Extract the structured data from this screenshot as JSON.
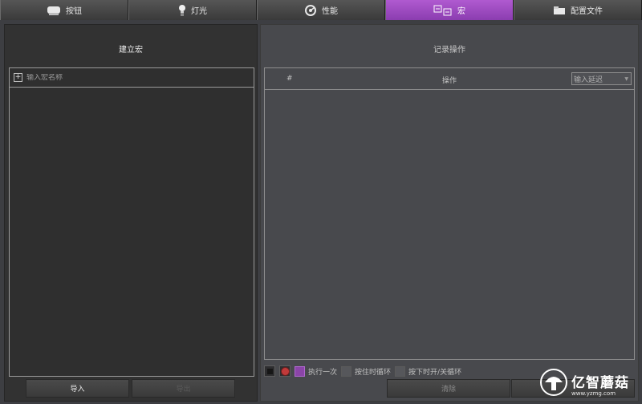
{
  "tabs": [
    {
      "label": "按钮",
      "icon": "mouse-icon",
      "active": false
    },
    {
      "label": "灯光",
      "icon": "bulb-icon",
      "active": false
    },
    {
      "label": "性能",
      "icon": "gauge-icon",
      "active": false
    },
    {
      "label": "宏",
      "icon": "macro-icon",
      "active": true
    },
    {
      "label": "配置文件",
      "icon": "folder-icon",
      "active": false
    }
  ],
  "left": {
    "title": "建立宏",
    "name_placeholder": "输入宏名称",
    "import_label": "导入",
    "export_label": "导出"
  },
  "right": {
    "title": "记录操作",
    "col_hash": "#",
    "col_op": "操作",
    "delay_placeholder": "输入延迟",
    "options": {
      "once": "执行一次",
      "hold": "按住时循环",
      "toggle": "按下时开/关循环"
    },
    "clear_label": "清除",
    "second_label": ""
  },
  "watermark": {
    "text": "亿智蘑菇",
    "url": "www.yzmg.com"
  },
  "colors": {
    "accent": "#9b4fc2",
    "panel_left": "#323232",
    "panel_right": "#48494d"
  }
}
